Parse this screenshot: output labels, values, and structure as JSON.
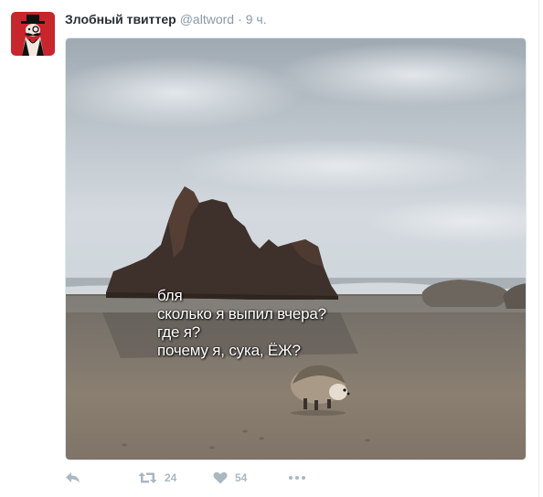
{
  "tweet": {
    "author_name": "Злобный твиттер",
    "handle": "@altword",
    "separator": "·",
    "time": "9 ч.",
    "image_caption": [
      "бля",
      "сколько я выпил вчера?",
      "где я?",
      "почему я, сука, ЁЖ?"
    ],
    "retweets": "24",
    "likes": "54"
  },
  "icons": {
    "reply": "reply-icon",
    "retweet": "retweet-icon",
    "like": "heart-icon",
    "more": "more-icon"
  },
  "colors": {
    "name": "#292f33",
    "meta": "#8899a6",
    "action_icons": "#aab8c2",
    "avatar_bg": "#c8252c"
  }
}
